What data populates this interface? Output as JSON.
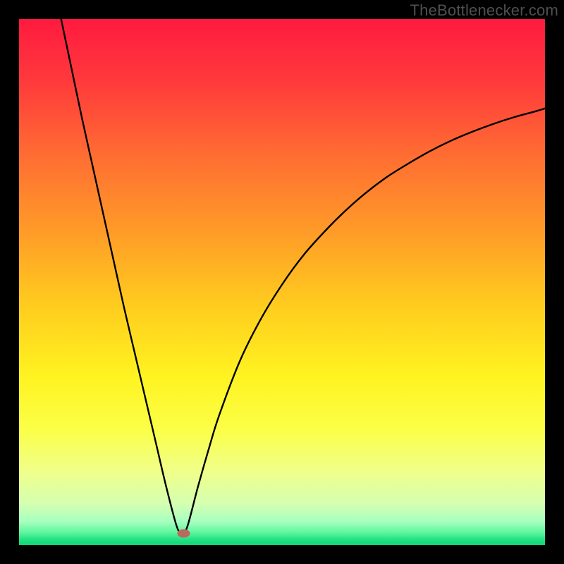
{
  "watermark": "TheBottlenecker.com",
  "chart_data": {
    "type": "line",
    "title": "",
    "xlabel": "",
    "ylabel": "",
    "xlim": [
      0,
      100
    ],
    "ylim": [
      0,
      100
    ],
    "series": [
      {
        "name": "curve",
        "x": [
          8,
          10,
          12,
          14,
          16,
          18,
          20,
          22,
          24,
          26,
          28,
          30,
          31,
          32,
          34,
          36,
          38,
          42,
          46,
          50,
          54,
          58,
          62,
          66,
          70,
          74,
          78,
          82,
          86,
          90,
          94,
          98,
          100
        ],
        "y": [
          100,
          90.5,
          81,
          72,
          63,
          54,
          45,
          36.5,
          28,
          19.5,
          11,
          3.5,
          2.3,
          3.5,
          11,
          18,
          24.5,
          35,
          43,
          49.5,
          55,
          59.5,
          63.5,
          67,
          70,
          72.5,
          74.8,
          76.8,
          78.5,
          80,
          81.3,
          82.4,
          83
        ]
      }
    ],
    "marker": {
      "x": 31.3,
      "y": 2.2,
      "color": "#b96a5e",
      "rx": 9,
      "ry": 6
    },
    "gradient_stops": [
      {
        "offset": 0.0,
        "color": "#ff1a3f"
      },
      {
        "offset": 0.12,
        "color": "#ff3a3c"
      },
      {
        "offset": 0.25,
        "color": "#ff6a33"
      },
      {
        "offset": 0.4,
        "color": "#ff9a28"
      },
      {
        "offset": 0.55,
        "color": "#ffce1e"
      },
      {
        "offset": 0.68,
        "color": "#fff321"
      },
      {
        "offset": 0.78,
        "color": "#fbff47"
      },
      {
        "offset": 0.86,
        "color": "#f0ff8a"
      },
      {
        "offset": 0.92,
        "color": "#d6ffb0"
      },
      {
        "offset": 0.955,
        "color": "#a8ffc0"
      },
      {
        "offset": 0.975,
        "color": "#63f7a0"
      },
      {
        "offset": 0.99,
        "color": "#22e183"
      },
      {
        "offset": 1.0,
        "color": "#0fd874"
      }
    ]
  }
}
